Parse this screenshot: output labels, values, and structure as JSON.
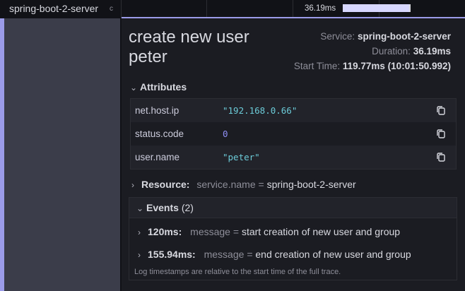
{
  "timeline": {
    "service_name": "spring-boot-2-server",
    "operation_truncated": "c",
    "duration_label": "36.19ms"
  },
  "detail": {
    "title": "create new user peter",
    "overview": {
      "service_label": "Service:",
      "service_value": "spring-boot-2-server",
      "duration_label": "Duration:",
      "duration_value": "36.19ms",
      "start_label": "Start Time:",
      "start_value": "119.77ms (10:01:50.992)"
    },
    "attributes": {
      "header": "Attributes",
      "rows": [
        {
          "key": "net.host.ip",
          "value": "\"192.168.0.66\"",
          "kind": "string"
        },
        {
          "key": "status.code",
          "value": "0",
          "kind": "number"
        },
        {
          "key": "user.name",
          "value": "\"peter\"",
          "kind": "string"
        }
      ]
    },
    "resource": {
      "label": "Resource:",
      "key": "service.name",
      "eq": "=",
      "value": "spring-boot-2-server"
    },
    "events": {
      "header": "Events",
      "count": "(2)",
      "items": [
        {
          "time": "120ms:",
          "key": "message",
          "eq": "=",
          "value": "start creation of new user and group"
        },
        {
          "time": "155.94ms:",
          "key": "message",
          "eq": "=",
          "value": "end creation of new user and group"
        }
      ],
      "note": "Log timestamps are relative to the start time of the full trace."
    }
  },
  "colors": {
    "accent": "#9b9be8",
    "string_value": "#6ccbd8",
    "number_value": "#8f8ff5",
    "background": "#1b1c22"
  },
  "icons": {
    "chevron": "chevron-down-icon",
    "chevron_collapsed": "chevron-right-icon",
    "copy": "copy-icon"
  }
}
